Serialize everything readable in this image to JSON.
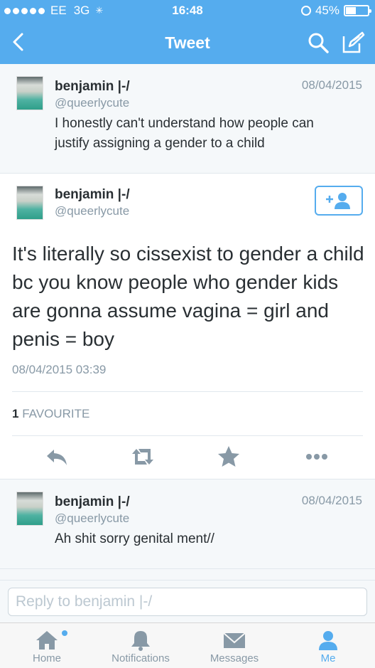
{
  "status_bar": {
    "carrier": "EE",
    "network": "3G",
    "time": "16:48",
    "battery": "45%",
    "battery_level": 0.45
  },
  "nav": {
    "title": "Tweet",
    "icons": [
      "back-arrow-icon",
      "search-icon",
      "compose-tweet-icon"
    ]
  },
  "tweets": {
    "parent": {
      "name": "benjamin |-/",
      "handle": "@queerlycute",
      "date": "08/04/2015",
      "text_line1": "I honestly can't understand how people can",
      "text_line2": "justify assigning a gender to a child"
    },
    "main": {
      "name": "benjamin |-/",
      "handle": "@queerlycute",
      "follow_icon": "add-user-icon",
      "text": "It's literally so cissexist to gender a child bc you know people who gender kids are gonna assume vagina = girl and penis = boy",
      "timestamp": "08/04/2015 03:39",
      "favourite_count": "1",
      "favourite_label": "FAVOURITE",
      "action_icons": [
        "reply-icon",
        "retweet-icon",
        "favorite-star-icon",
        "more-icon"
      ]
    },
    "reply": {
      "name": "benjamin |-/",
      "handle": "@queerlycute",
      "date": "08/04/2015",
      "text": "Ah shit sorry genital ment//"
    }
  },
  "reply_box": {
    "placeholder": "Reply to benjamin |-/"
  },
  "tabs": [
    {
      "label": "Home",
      "icon": "home-icon",
      "active": false,
      "has_notification_dot": true
    },
    {
      "label": "Notifications",
      "icon": "bell-icon",
      "active": false
    },
    {
      "label": "Messages",
      "icon": "envelope-icon",
      "active": false
    },
    {
      "label": "Me",
      "icon": "person-icon",
      "active": true
    }
  ],
  "colors": {
    "brand": "#55acee",
    "text": "#292f33",
    "muted": "#8899a6",
    "background": "#f5f8fa"
  }
}
